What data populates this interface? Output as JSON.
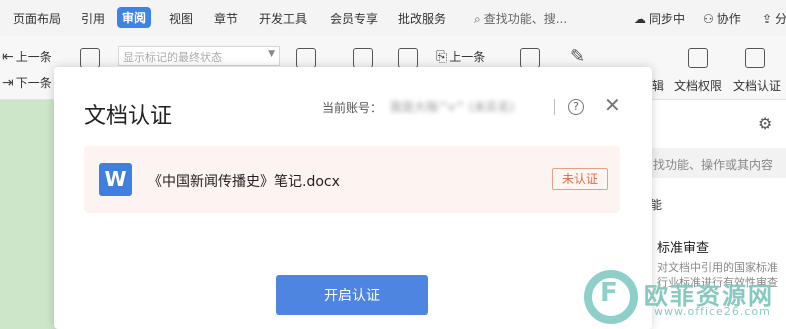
{
  "menubar": {
    "items": [
      "页面布局",
      "引用",
      "审阅",
      "视图",
      "章节",
      "开发工具",
      "会员专享",
      "批改服务"
    ],
    "active": "审阅",
    "search_placeholder": "查找功能、搜...",
    "sync": "同步中",
    "collab": "协作",
    "share": "分"
  },
  "ribbon": {
    "prev_change": "上一条",
    "next_change": "下一条",
    "markup_select": "显示标记的最终状态",
    "prev_comment": "上一条",
    "edit_partial": "辑",
    "doc_permission": "文档权限",
    "doc_certify": "文档认证"
  },
  "sidepanel": {
    "search_placeholder": "找功能、操作或其内容",
    "section": "能",
    "item_title": "标准审查",
    "item_desc_1": "对文档中引用的国家标准",
    "item_desc_2": "行业标准进行有效性审查"
  },
  "dialog": {
    "title": "文档认证",
    "account_label": "当前账号：",
    "account_value": "我是大咖^v^  (未实名)",
    "help": "?",
    "close": "✕",
    "file_icon_letter": "W",
    "file_name": "《中国新闻传播史》笔记.docx",
    "status": "未认证",
    "start_button": "开启认证"
  },
  "watermark": {
    "logo_letter": "F",
    "text": "欧菲资源网",
    "url": "www.office26.com"
  },
  "colors": {
    "accent": "#4d85e0",
    "status": "#e06a4a",
    "file_icon": "#3f7fdd"
  }
}
